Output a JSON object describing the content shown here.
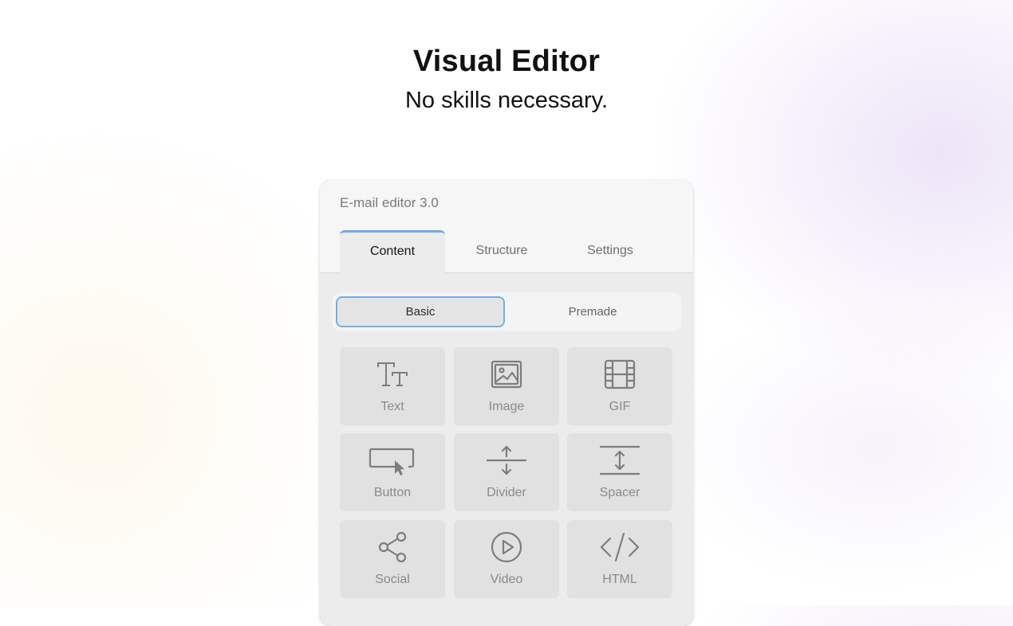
{
  "hero": {
    "title": "Visual Editor",
    "subtitle": "No skills necessary."
  },
  "editor": {
    "title": "E-mail editor 3.0",
    "tabs": [
      {
        "label": "Content",
        "active": true
      },
      {
        "label": "Structure",
        "active": false
      },
      {
        "label": "Settings",
        "active": false
      }
    ],
    "segments": [
      {
        "label": "Basic",
        "selected": true
      },
      {
        "label": "Premade",
        "selected": false
      }
    ],
    "blocks": [
      {
        "label": "Text",
        "icon": "text-icon"
      },
      {
        "label": "Image",
        "icon": "image-icon"
      },
      {
        "label": "GIF",
        "icon": "gif-icon"
      },
      {
        "label": "Button",
        "icon": "button-icon"
      },
      {
        "label": "Divider",
        "icon": "divider-icon"
      },
      {
        "label": "Spacer",
        "icon": "spacer-icon"
      },
      {
        "label": "Social",
        "icon": "share-icon"
      },
      {
        "label": "Video",
        "icon": "play-icon"
      },
      {
        "label": "HTML",
        "icon": "code-icon"
      }
    ]
  },
  "colors": {
    "accent": "#6ea8e8",
    "panel_bg": "#ececec",
    "tile_bg": "#e1e1e1",
    "icon": "#7d7d7d"
  }
}
